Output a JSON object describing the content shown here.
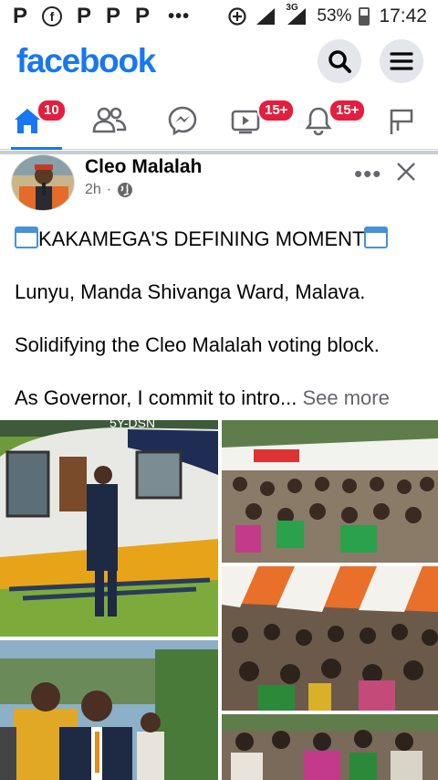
{
  "status_bar": {
    "left_icons": [
      "pinterest-icon",
      "facebook-icon",
      "pinterest-icon",
      "pinterest-icon",
      "pinterest-icon"
    ],
    "p_glyph": "P",
    "fb_glyph": "f",
    "more": "•••",
    "network": "3G",
    "battery": "53%",
    "time": "17:42"
  },
  "header": {
    "logo": "facebook"
  },
  "nav": {
    "home_badge": "10",
    "video_badge": "15+",
    "notifications_badge": "15+"
  },
  "post": {
    "author": "Cleo Malalah",
    "time": "2h",
    "more_label": "•••",
    "headline": "KAKAMEGA'S DEFINING MOMENT",
    "line1": "Lunyu, Manda Shivanga Ward, Malava.",
    "line2": "Solidifying the Cleo Malalah voting block.",
    "line3": "As Governor, I commit to intro...",
    "see_more": "See more"
  },
  "colors": {
    "brand": "#1877f2",
    "badge": "#e41e3f"
  }
}
